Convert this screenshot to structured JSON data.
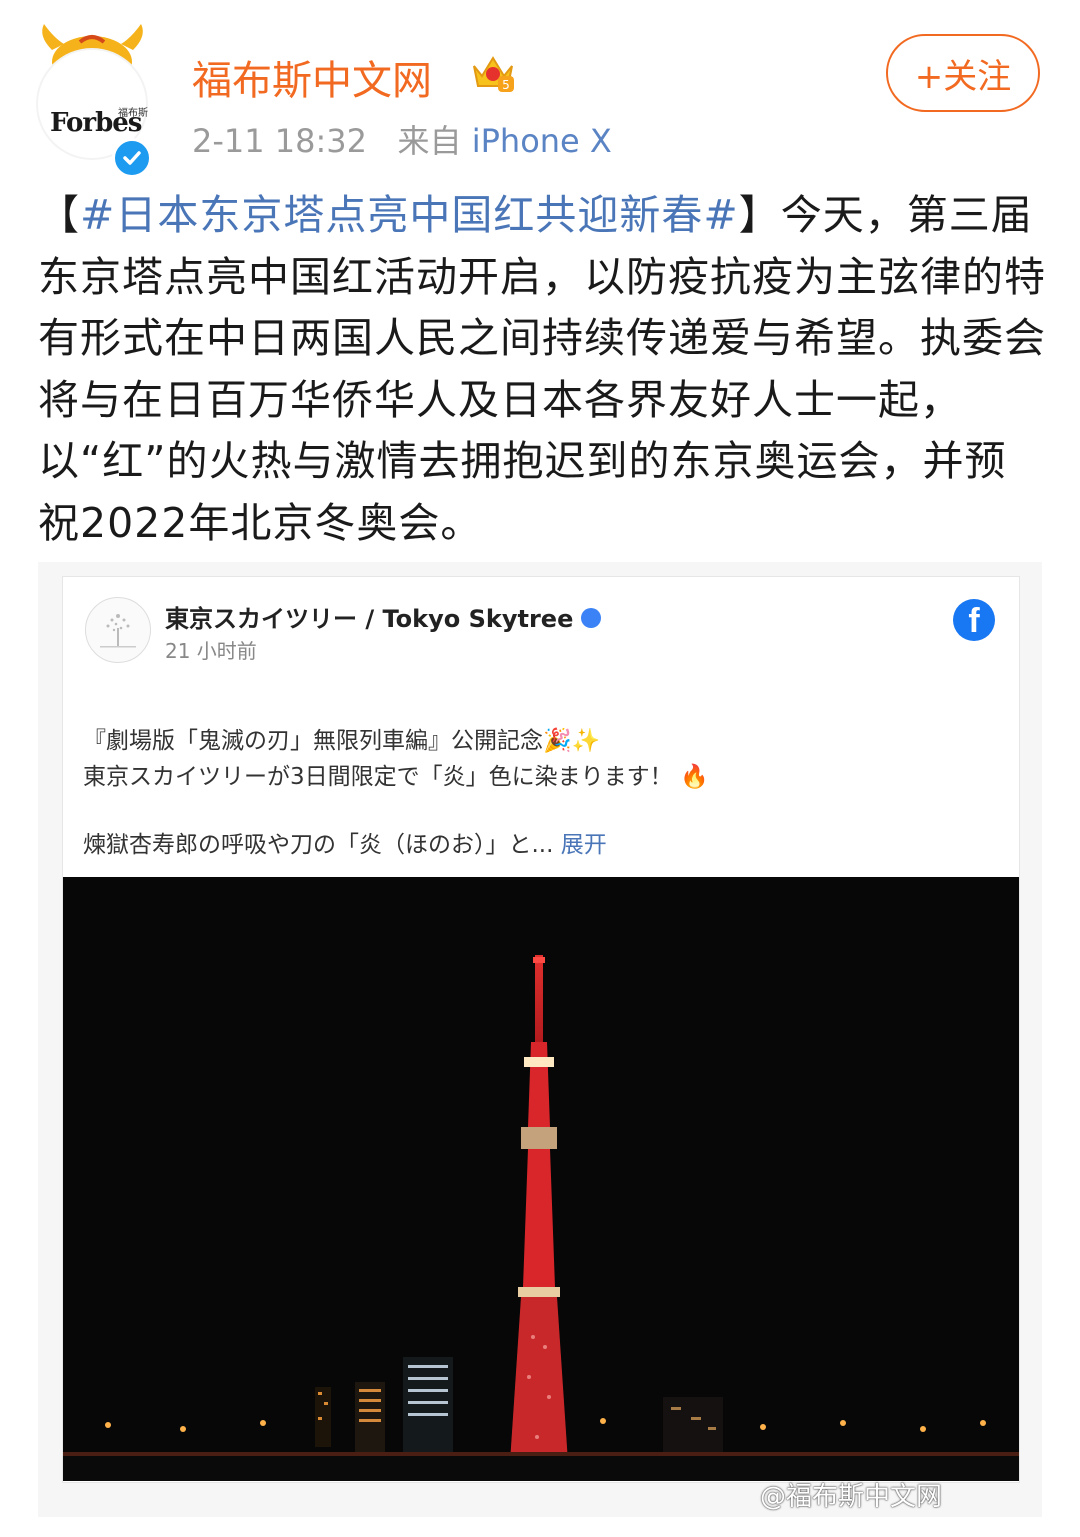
{
  "header": {
    "username": "福布斯中文网",
    "timestamp": "2-11 18:32",
    "source_prefix": "来自",
    "source_device": "iPhone X",
    "follow_label": "+关注",
    "avatar_brand": "Forbes",
    "avatar_brand_cn": "福布斯"
  },
  "post": {
    "bracket_open": "【",
    "hashtag": "#日本东京塔点亮中国红共迎新春#",
    "bracket_close": "】",
    "body": "今天，第三届东京塔点亮中国红活动开启，以防疫抗疫为主弦律的特有形式在中日两国人民之间持续传递爱与希望。执委会将与在日百万华侨华人及日本各界友好人士一起，以“红”的火热与激情去拥抱迟到的东京奥运会，并预祝2022年北京冬奥会。"
  },
  "embed": {
    "account_name": "東京スカイツリー / Tokyo Skytree",
    "time": "21 小时前",
    "line1": "『劇場版「鬼滅の刃」無限列車編』公開記念🎉✨",
    "line2": "東京スカイツリーが3日間限定で「炎」色に染まります！ 🔥",
    "line3": "煉獄杏寿郎の呼吸や刀の「炎（ほのお）」と...",
    "more_label": "展开"
  },
  "watermark": "@福布斯中文网",
  "colors": {
    "brand_orange": "#f26a21",
    "link_blue": "#4a76b8",
    "verified_blue": "#1d9bf0",
    "facebook_blue": "#1877f2",
    "tower_red": "#d8262b"
  }
}
